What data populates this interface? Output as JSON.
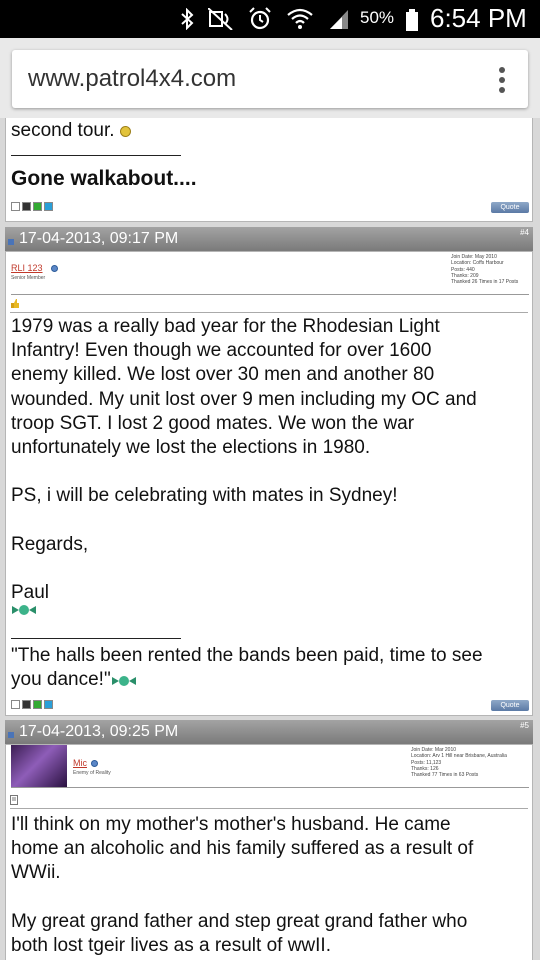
{
  "status_bar": {
    "battery": "50%",
    "time": "6:54 PM"
  },
  "browser": {
    "url": "www.patrol4x4.com"
  },
  "prev_post": {
    "tail_text": "second tour.",
    "signature": "Gone walkabout....",
    "quote_label": "Quote"
  },
  "posts": [
    {
      "date": "17-04-2013, 09:17 PM",
      "number": "#4",
      "username": "RLI 123",
      "user_title": "Senior Member",
      "user_info": [
        "Join Date: May 2010",
        "Location: Coffs Harbour",
        "Posts: 440",
        "Thanks: 209",
        "Thanked 26 Times in 17 Posts"
      ],
      "body": [
        "1979 was a really bad year for the Rhodesian Light",
        "Infantry! Even though we accounted for over 1600",
        "enemy killed. We lost over 30 men and another 80",
        "wounded. My unit lost over 9 men including my OC and",
        "troop SGT. I lost 2 good mates. We won the war",
        "unfortunately we lost the elections in 1980.",
        "",
        "PS, i will be celebrating with mates in Sydney!",
        "",
        "Regards,",
        "",
        "Paul"
      ],
      "signature": [
        "\"The halls been rented the bands been paid, time to see",
        "you dance!\""
      ],
      "quote_label": "Quote"
    },
    {
      "date": "17-04-2013, 09:25 PM",
      "number": "#5",
      "username": "Mic",
      "user_title": "Enemy of Reality",
      "user_info": [
        "Join Date: Mar 2010",
        "Location: Arv 1 Hill near Brisbane, Australia",
        "Posts: 11,123",
        "Thanks: 126",
        "Thanked 77 Times in 63 Posts"
      ],
      "body": [
        "I'll think on my mother's mother's husband. He came",
        "home an alcoholic and his family suffered as a result of",
        "WWii.",
        "",
        "My great grand father and step great grand father who",
        "both lost tgeir lives as a result of wwII."
      ]
    }
  ]
}
